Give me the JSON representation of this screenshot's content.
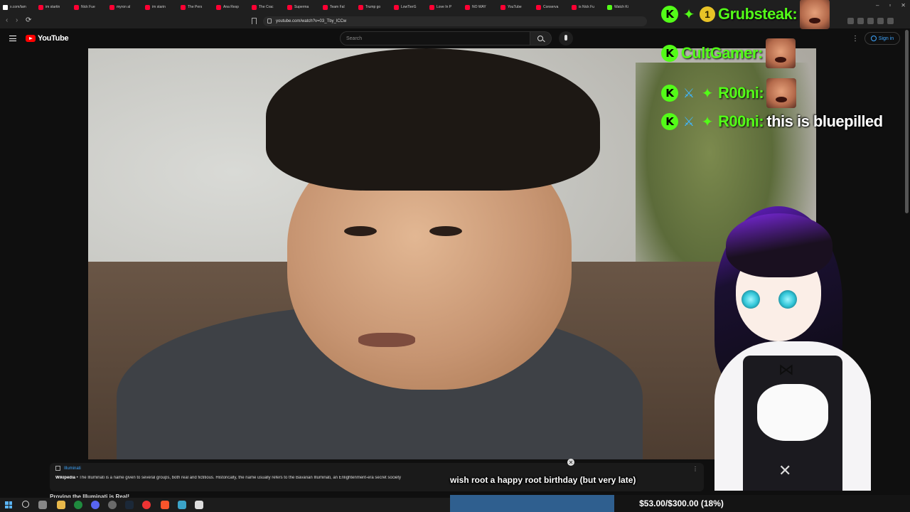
{
  "browser": {
    "tabs": [
      {
        "label": "x.com/lam",
        "type": "x"
      },
      {
        "label": "im startin",
        "type": "yt"
      },
      {
        "label": "Nick Fue",
        "type": "yt"
      },
      {
        "label": "myron al",
        "type": "yt"
      },
      {
        "label": "im starin",
        "type": "yt"
      },
      {
        "label": "The Pers",
        "type": "yt"
      },
      {
        "label": "Ana Resp",
        "type": "yt"
      },
      {
        "label": "The Crac",
        "type": "yt"
      },
      {
        "label": "Superma",
        "type": "yt"
      },
      {
        "label": "Team Fal",
        "type": "yt"
      },
      {
        "label": "Trump go",
        "type": "yt"
      },
      {
        "label": "LowTierG",
        "type": "yt"
      },
      {
        "label": "Love In P",
        "type": "yt"
      },
      {
        "label": "NO WAY",
        "type": "yt"
      },
      {
        "label": "YouTube",
        "type": "yt"
      },
      {
        "label": "Conserva",
        "type": "yt"
      },
      {
        "label": "is Nick Fu",
        "type": "yt"
      },
      {
        "label": "Watch Ki",
        "type": "kick"
      }
    ],
    "url": "youtube.com/watch?v=03_Tby_lCCw",
    "window_controls": {
      "minimize": "–",
      "restore": "▫",
      "close": "✕"
    }
  },
  "youtube": {
    "logo_text": "YouTube",
    "search_placeholder": "Search",
    "more": "⋮",
    "sign_in": "Sign in"
  },
  "chat": {
    "messages": [
      {
        "badges": [
          "kick",
          "star",
          "one"
        ],
        "user": "Grubsteak:",
        "text": "",
        "emote": true
      },
      {
        "badges": [
          "kick"
        ],
        "user": "CultGamer:",
        "text": "",
        "emote": true
      },
      {
        "badges": [
          "kick",
          "sword",
          "star"
        ],
        "user": "R00ni:",
        "text": "",
        "emote": true
      },
      {
        "badges": [
          "kick",
          "sword",
          "star"
        ],
        "user": "R00ni:",
        "text": "this is bluepilled",
        "emote": false
      }
    ],
    "badge_glyphs": {
      "kick": "K",
      "sword": "⚔",
      "star": "✦",
      "one": "1"
    }
  },
  "wiki_panel": {
    "topic": "Illuminati",
    "source": "Wikipedia",
    "description": "• The Illuminati is a name given to several groups, both real and fictitious. Historically, the name usually refers to the Bavarian Illuminati, an Enlightenment-era secret society",
    "more_icon": "⋮",
    "close_glyph": "✕",
    "next_title": "Proving the Illuminati is Real!"
  },
  "overlay": {
    "subtitle": "wish root a happy root birthday (but very late)",
    "donation": {
      "text": "$53.00/$300.00 (18%)",
      "progress": 0.18,
      "fill_color": "#2f5f8f"
    }
  },
  "colors": {
    "kick_green": "#53fc18",
    "yt_red": "#ff0000",
    "link_blue": "#3ea6ff"
  }
}
